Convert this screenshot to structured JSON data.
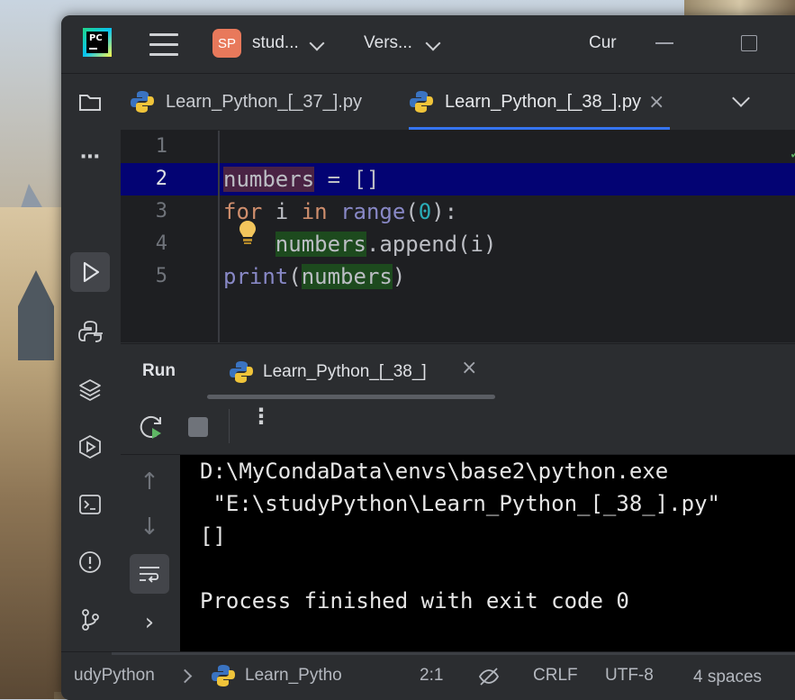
{
  "titlebar": {
    "app_logo_text": "PC",
    "project_badge": "SP",
    "project_name": "stud...",
    "vcs_label": "Vers...",
    "run_config": "Cur"
  },
  "tabs": [
    {
      "label": "Learn_Python_[_37_].py",
      "active": false
    },
    {
      "label": "Learn_Python_[_38_].py",
      "active": true
    }
  ],
  "editor": {
    "current_line": 2,
    "lines": [
      {
        "no": "1"
      },
      {
        "no": "2"
      },
      {
        "no": "3"
      },
      {
        "no": "4"
      },
      {
        "no": "5"
      }
    ],
    "tokens": {
      "l2_var": "numbers",
      "l2_rest": " = []",
      "l3_for": "for",
      "l3_i": " i ",
      "l3_in": "in",
      "l3_range": "range",
      "l3_open": "(",
      "l3_zero": "0",
      "l3_close": "):",
      "l4_indent": "    ",
      "l4_var": "numbers",
      "l4_rest": ".append(i)",
      "l5_print": "print",
      "l5_open": "(",
      "l5_var": "numbers",
      "l5_close": ")"
    }
  },
  "run_panel": {
    "title": "Run",
    "tab_label": "Learn_Python_[_38_]",
    "console_lines": [
      "D:\\MyCondaData\\envs\\base2\\python.exe",
      " \"E:\\studyPython\\Learn_Python_[_38_].py\"",
      "[]",
      "",
      "Process finished with exit code 0"
    ]
  },
  "statusbar": {
    "breadcrumb_project": "udyPython",
    "breadcrumb_file": "Learn_Pytho",
    "position": "2:1",
    "line_separator": "CRLF",
    "encoding": "UTF-8",
    "indent": "4 spaces"
  },
  "colors": {
    "accent": "#3574f0",
    "background": "#2b2d30",
    "editor_bg": "#1e1f22",
    "current_line": "#030373",
    "keyword": "#cf8e6d",
    "builtin": "#8888c6",
    "number": "#2aacb8"
  },
  "icons": {
    "close": "×",
    "more": "⋮",
    "ellipsis": "⋯"
  }
}
